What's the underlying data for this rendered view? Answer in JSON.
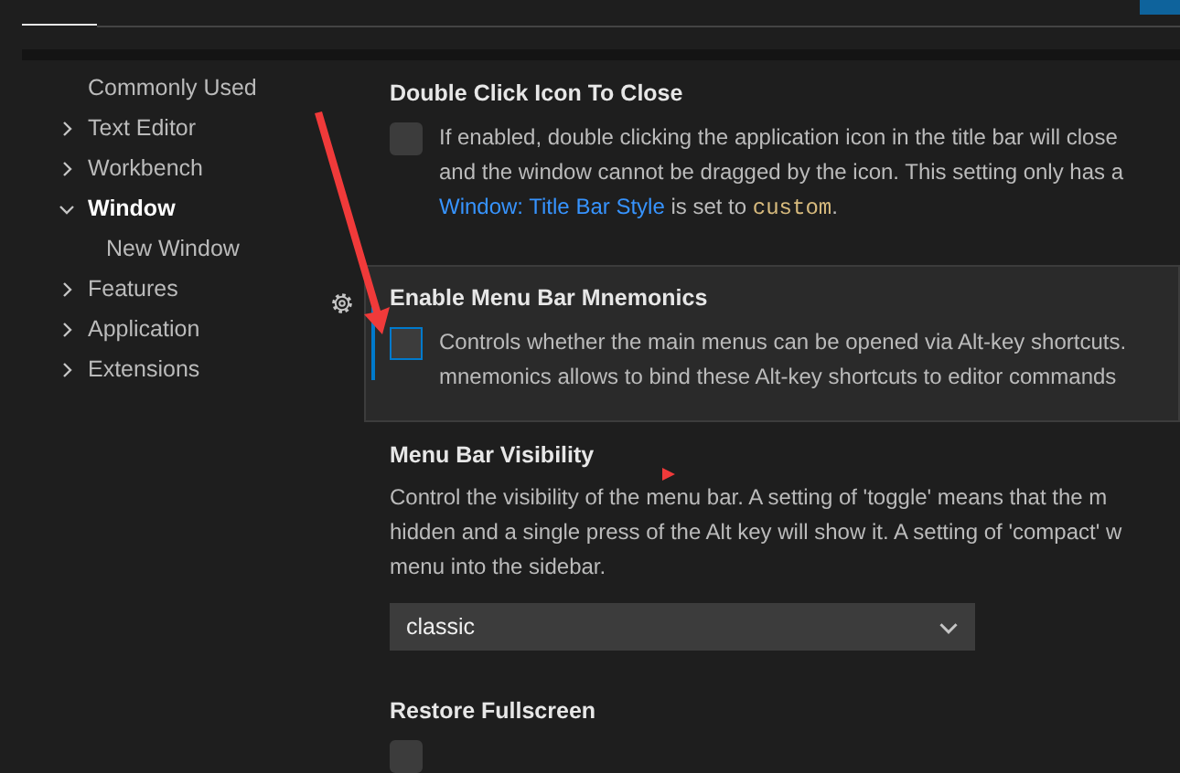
{
  "sidebar": {
    "items": [
      {
        "label": "Commonly Used",
        "selected": false
      },
      {
        "label": "Text Editor",
        "expanded": false,
        "selected": false
      },
      {
        "label": "Workbench",
        "expanded": false,
        "selected": false
      },
      {
        "label": "Window",
        "expanded": true,
        "selected": true,
        "children": [
          {
            "label": "New Window",
            "selected": false
          }
        ]
      },
      {
        "label": "Features",
        "expanded": false,
        "selected": false
      },
      {
        "label": "Application",
        "expanded": false,
        "selected": false
      },
      {
        "label": "Extensions",
        "expanded": false,
        "selected": false
      }
    ]
  },
  "settings": [
    {
      "kind": "checkbox",
      "title": "Double Click Icon To Close",
      "focused": false,
      "checked": false,
      "lines": [
        [
          {
            "kind": "text",
            "text": "If enabled, double clicking the application icon in the title bar will close"
          }
        ],
        [
          {
            "kind": "text",
            "text": "and the window cannot be dragged by the icon. This setting only has a"
          }
        ],
        [
          {
            "kind": "link",
            "text": "Window: Title Bar Style"
          },
          {
            "kind": "text",
            "text": " is set to "
          },
          {
            "kind": "code",
            "text": "custom"
          },
          {
            "kind": "text",
            "text": "."
          }
        ]
      ]
    },
    {
      "kind": "checkbox",
      "title": "Enable Menu Bar Mnemonics",
      "focused": true,
      "checked": false,
      "lines": [
        [
          {
            "kind": "text",
            "text": "Controls whether the main menus can be opened via Alt-key shortcuts."
          }
        ],
        [
          {
            "kind": "text",
            "text": "mnemonics allows to bind these Alt-key shortcuts to editor commands"
          }
        ]
      ]
    },
    {
      "kind": "dropdown",
      "title": "Menu Bar Visibility",
      "focused": false,
      "value": "classic",
      "lines": [
        [
          {
            "kind": "text",
            "text": "Control the visibility of the menu bar. A setting of 'toggle' means that the m"
          }
        ],
        [
          {
            "kind": "text",
            "text": "hidden and a single press of the Alt key will show it. A setting of 'compact' w"
          }
        ],
        [
          {
            "kind": "text",
            "text": "menu into the sidebar."
          }
        ]
      ]
    },
    {
      "kind": "checkbox",
      "title": "Restore Fullscreen",
      "focused": false,
      "checked": false
    }
  ]
}
